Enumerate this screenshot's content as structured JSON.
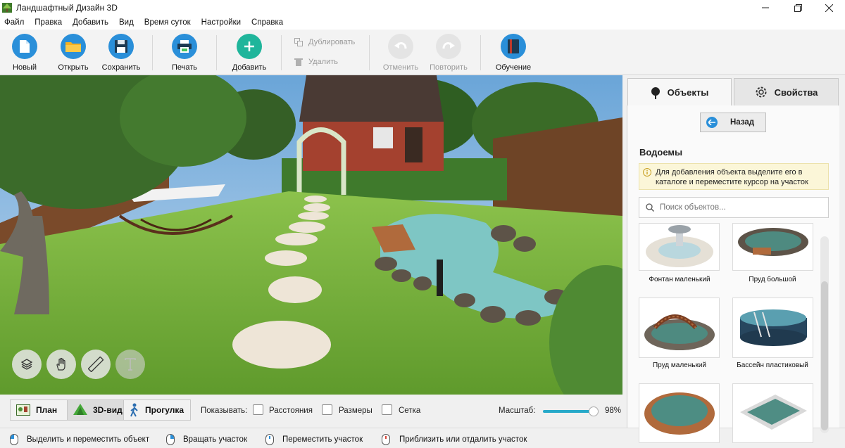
{
  "window": {
    "title": "Ландшафтный Дизайн 3D"
  },
  "menu": [
    "Файл",
    "Правка",
    "Добавить",
    "Вид",
    "Время суток",
    "Настройки",
    "Справка"
  ],
  "toolbar": {
    "new_label": "Новый",
    "open_label": "Открыть",
    "save_label": "Сохранить",
    "print_label": "Печать",
    "add_label": "Добавить",
    "duplicate_label": "Дублировать",
    "delete_label": "Удалить",
    "undo_label": "Отменить",
    "redo_label": "Повторить",
    "tutorial_label": "Обучение"
  },
  "view_modes": {
    "plan_label": "План",
    "view3d_label": "3D-вид",
    "walk_label": "Прогулка",
    "active": "3D-вид"
  },
  "show": {
    "label": "Показывать:",
    "distances_label": "Расстояния",
    "sizes_label": "Размеры",
    "grid_label": "Сетка",
    "distances_checked": false,
    "sizes_checked": false,
    "grid_checked": false
  },
  "zoom": {
    "label": "Масштаб:",
    "value_text": "98%",
    "value": 0.98
  },
  "status_hints": {
    "select_label": "Выделить и переместить объект",
    "rotate_label": "Вращать участок",
    "move_label": "Переместить участок",
    "zoom_label": "Приблизить или отдалить участок"
  },
  "panel": {
    "tab_objects_label": "Объекты",
    "tab_properties_label": "Свойства",
    "active_tab": "Объекты",
    "back_label": "Назад",
    "section_title": "Водоемы",
    "info_text": "Для добавления объекта выделите его в каталоге и переместите курсор на участок",
    "search_placeholder": "Поиск объектов...",
    "items": [
      {
        "label": "Фонтан маленький"
      },
      {
        "label": "Пруд большой"
      },
      {
        "label": "Пруд маленький"
      },
      {
        "label": "Бассейн пластиковый"
      },
      {
        "label": ""
      },
      {
        "label": ""
      }
    ]
  },
  "colors": {
    "accent": "#27a9c9",
    "add_button": "#1fb59b",
    "info_bg": "#fbf6d8",
    "grass": "#6fae3a",
    "water": "#7ec6c4"
  }
}
